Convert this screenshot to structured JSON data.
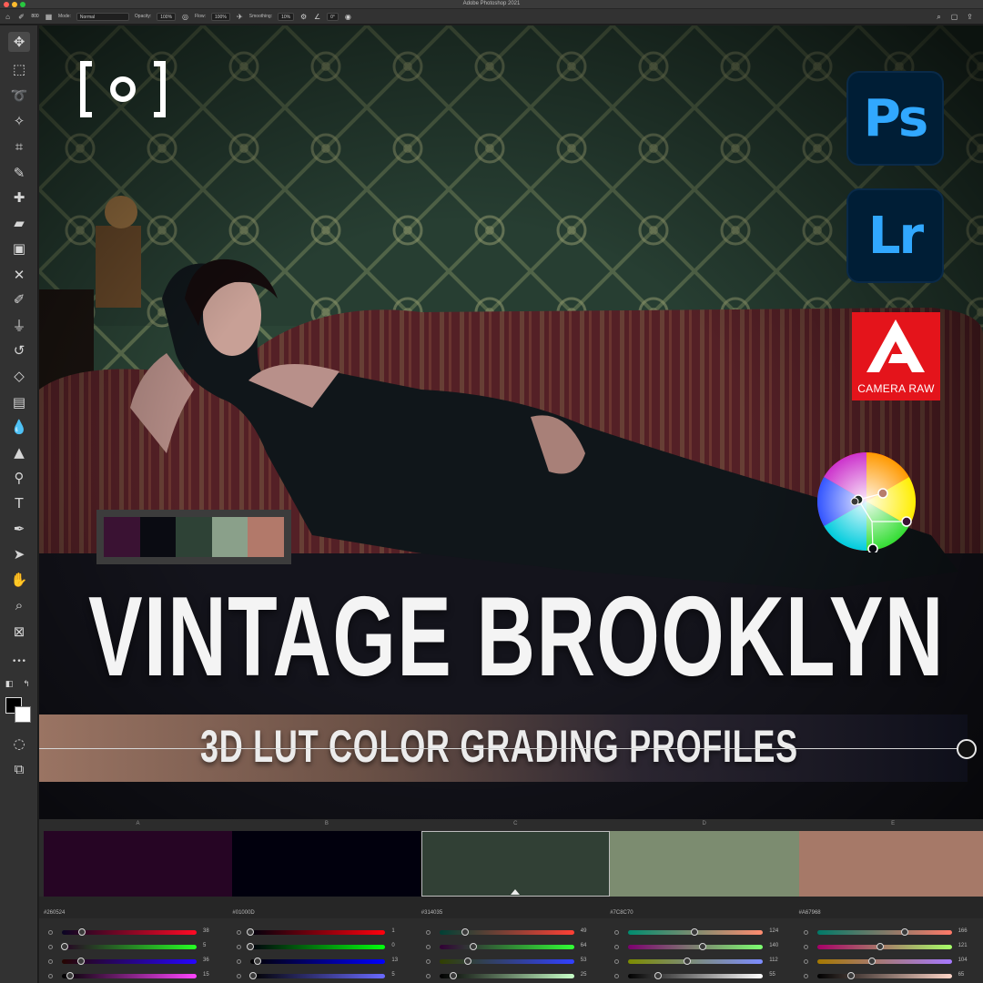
{
  "window": {
    "title": "Adobe Photoshop 2021"
  },
  "options_bar": {
    "mode_label": "Mode:",
    "mode_value": "Normal",
    "opacity_label": "Opacity:",
    "opacity_value": "100%",
    "flow_label": "Flow:",
    "flow_value": "100%",
    "smoothing_label": "Smoothing:",
    "smoothing_value": "10%",
    "angle_value": "0°",
    "brush_size": "800"
  },
  "toolbar": {
    "tools": [
      {
        "name": "move-tool",
        "icon": "move-icon",
        "glyph": "✥"
      },
      {
        "name": "marquee-tool",
        "icon": "marquee-icon",
        "glyph": "⬚"
      },
      {
        "name": "lasso-tool",
        "icon": "lasso-icon",
        "glyph": "➰"
      },
      {
        "name": "magic-wand-tool",
        "icon": "magic-wand-icon",
        "glyph": "✧"
      },
      {
        "name": "crop-tool",
        "icon": "crop-icon",
        "glyph": "⌗"
      },
      {
        "name": "eyedropper-tool",
        "icon": "eyedropper-icon",
        "glyph": "✎"
      },
      {
        "name": "healing-brush-tool",
        "icon": "bandage-icon",
        "glyph": "✚"
      },
      {
        "name": "patch-tool",
        "icon": "patch-icon",
        "glyph": "▰"
      },
      {
        "name": "frame-tool",
        "icon": "frame-icon",
        "glyph": "▣"
      },
      {
        "name": "content-aware-move-tool",
        "icon": "cross-arrows-icon",
        "glyph": "✕"
      },
      {
        "name": "brush-tool",
        "icon": "brush-icon",
        "glyph": "✐"
      },
      {
        "name": "stamp-tool",
        "icon": "stamp-icon",
        "glyph": "⏚"
      },
      {
        "name": "history-brush-tool",
        "icon": "history-brush-icon",
        "glyph": "↺"
      },
      {
        "name": "eraser-tool",
        "icon": "eraser-icon",
        "glyph": "◇"
      },
      {
        "name": "gradient-tool",
        "icon": "gradient-icon",
        "glyph": "▤"
      },
      {
        "name": "blur-tool",
        "icon": "drop-icon",
        "glyph": "💧"
      },
      {
        "name": "sharpen-tool",
        "icon": "triangle-icon",
        "glyph": "▲"
      },
      {
        "name": "dodge-tool",
        "icon": "dodge-icon",
        "glyph": "⚲"
      },
      {
        "name": "type-tool",
        "icon": "type-icon",
        "glyph": "T"
      },
      {
        "name": "pen-tool",
        "icon": "pen-icon",
        "glyph": "✒"
      },
      {
        "name": "path-selection-tool",
        "icon": "arrow-cursor-icon",
        "glyph": "➤"
      },
      {
        "name": "hand-tool",
        "icon": "hand-icon",
        "glyph": "✋"
      },
      {
        "name": "zoom-tool",
        "icon": "zoom-icon",
        "glyph": "⌕"
      },
      {
        "name": "artboard-tool",
        "icon": "artboard-icon",
        "glyph": "⊠"
      },
      {
        "name": "more-tools",
        "icon": "ellipsis-icon",
        "glyph": "•••"
      }
    ]
  },
  "canvas": {
    "headline": "VINTAGE BROOKLYN",
    "subheadline": "3D LUT COLOR GRADING PROFILES",
    "badges": {
      "ps": "Ps",
      "lr": "Lr",
      "camera_raw": "CAMERA RAW"
    },
    "mini_palette": [
      "#3a1233",
      "#0a0b12",
      "#2e4236",
      "#8aa08a",
      "#b2796a"
    ]
  },
  "palette": {
    "columns": [
      {
        "letter": "A",
        "hex": "#260524",
        "color": "#260524",
        "channels": [
          {
            "value": "38",
            "level": 0.15,
            "gradient": "linear-gradient(90deg,#0a0524,#ff0a24)"
          },
          {
            "value": "5",
            "level": 0.02,
            "gradient": "linear-gradient(90deg,#260024,#26ff24)"
          },
          {
            "value": "36",
            "level": 0.14,
            "gradient": "linear-gradient(90deg,#260500,#2605ff)"
          },
          {
            "value": "15",
            "level": 0.06,
            "gradient": "linear-gradient(90deg,#000,#ff44ff)"
          }
        ]
      },
      {
        "letter": "B",
        "hex": "#01000D",
        "color": "#01000d",
        "channels": [
          {
            "value": "1",
            "level": 0.0,
            "gradient": "linear-gradient(90deg,#00000d,#ff000d)"
          },
          {
            "value": "0",
            "level": 0.0,
            "gradient": "linear-gradient(90deg,#01000d,#01ff0d)"
          },
          {
            "value": "13",
            "level": 0.05,
            "gradient": "linear-gradient(90deg,#010000,#0100ff)"
          },
          {
            "value": "5",
            "level": 0.02,
            "gradient": "linear-gradient(90deg,#000,#6a6aff)"
          }
        ]
      },
      {
        "letter": "C",
        "hex": "#314035",
        "color": "#314035",
        "channels": [
          {
            "value": "49",
            "level": 0.19,
            "gradient": "linear-gradient(90deg,#004035,#ff4035)"
          },
          {
            "value": "64",
            "level": 0.25,
            "gradient": "linear-gradient(90deg,#310035,#31ff35)"
          },
          {
            "value": "53",
            "level": 0.21,
            "gradient": "linear-gradient(90deg,#314000,#3140ff)"
          },
          {
            "value": "25",
            "level": 0.1,
            "gradient": "linear-gradient(90deg,#000,#c8ffc8)"
          }
        ]
      },
      {
        "letter": "D",
        "hex": "#7C8C70",
        "color": "#7c8c70",
        "channels": [
          {
            "value": "124",
            "level": 0.49,
            "gradient": "linear-gradient(90deg,#008c70,#ff8c70)"
          },
          {
            "value": "140",
            "level": 0.55,
            "gradient": "linear-gradient(90deg,#7c0070,#7cff70)"
          },
          {
            "value": "112",
            "level": 0.44,
            "gradient": "linear-gradient(90deg,#7c8c00,#7c8cff)"
          },
          {
            "value": "55",
            "level": 0.22,
            "gradient": "linear-gradient(90deg,#000,#ffffff)"
          }
        ]
      },
      {
        "letter": "E",
        "hex": "#A67968",
        "color": "#a67968",
        "channels": [
          {
            "value": "166",
            "level": 0.65,
            "gradient": "linear-gradient(90deg,#007968,#ff7968)"
          },
          {
            "value": "121",
            "level": 0.47,
            "gradient": "linear-gradient(90deg,#a60068,#a6ff68)"
          },
          {
            "value": "104",
            "level": 0.41,
            "gradient": "linear-gradient(90deg,#a67900,#a679ff)"
          },
          {
            "value": "65",
            "level": 0.25,
            "gradient": "linear-gradient(90deg,#000,#ffd6c8)"
          }
        ]
      }
    ],
    "selected_index": 2
  }
}
